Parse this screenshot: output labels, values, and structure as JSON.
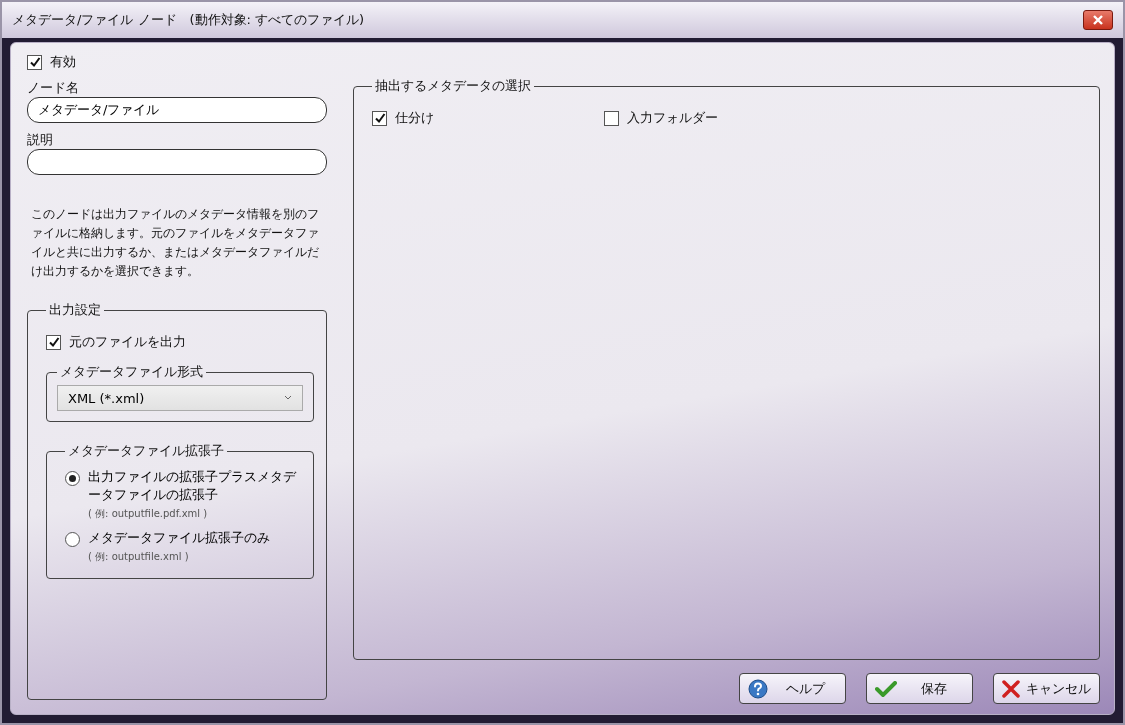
{
  "window": {
    "title": "メタデータ/ファイル ノード　(動作対象: すべてのファイル)"
  },
  "enabled": {
    "label": "有効",
    "checked": true
  },
  "node_name": {
    "label": "ノード名",
    "value": "メタデータ/ファイル"
  },
  "description": {
    "label": "説明"
  },
  "info_text": "このノードは出力ファイルのメタデータ情報を別のファイルに格納します。元のファイルをメタデータファイルと共に出力するか、またはメタデータファイルだけ出力するかを選択できます。",
  "output_settings": {
    "title": "出力設定",
    "output_original": {
      "label": "元のファイルを出力",
      "checked": true
    },
    "format": {
      "title": "メタデータファイル形式",
      "value": "XML (*.xml)"
    },
    "extension": {
      "title": "メタデータファイル拡張子",
      "options": [
        {
          "label": "出力ファイルの拡張子プラスメタデータファイルの拡張子",
          "example": "( 例: outputfile.pdf.xml )",
          "selected": true
        },
        {
          "label": "メタデータファイル拡張子のみ",
          "example": "( 例: outputfile.xml )",
          "selected": false
        }
      ]
    }
  },
  "metadata_selection": {
    "title": "抽出するメタデータの選択",
    "items": [
      {
        "label": "仕分け",
        "checked": true
      },
      {
        "label": "入力フォルダー",
        "checked": false
      }
    ]
  },
  "buttons": [
    {
      "kind": "help",
      "label": "ヘルプ"
    },
    {
      "kind": "save",
      "label": "保存"
    },
    {
      "kind": "cancel",
      "label": "キャンセル"
    }
  ]
}
